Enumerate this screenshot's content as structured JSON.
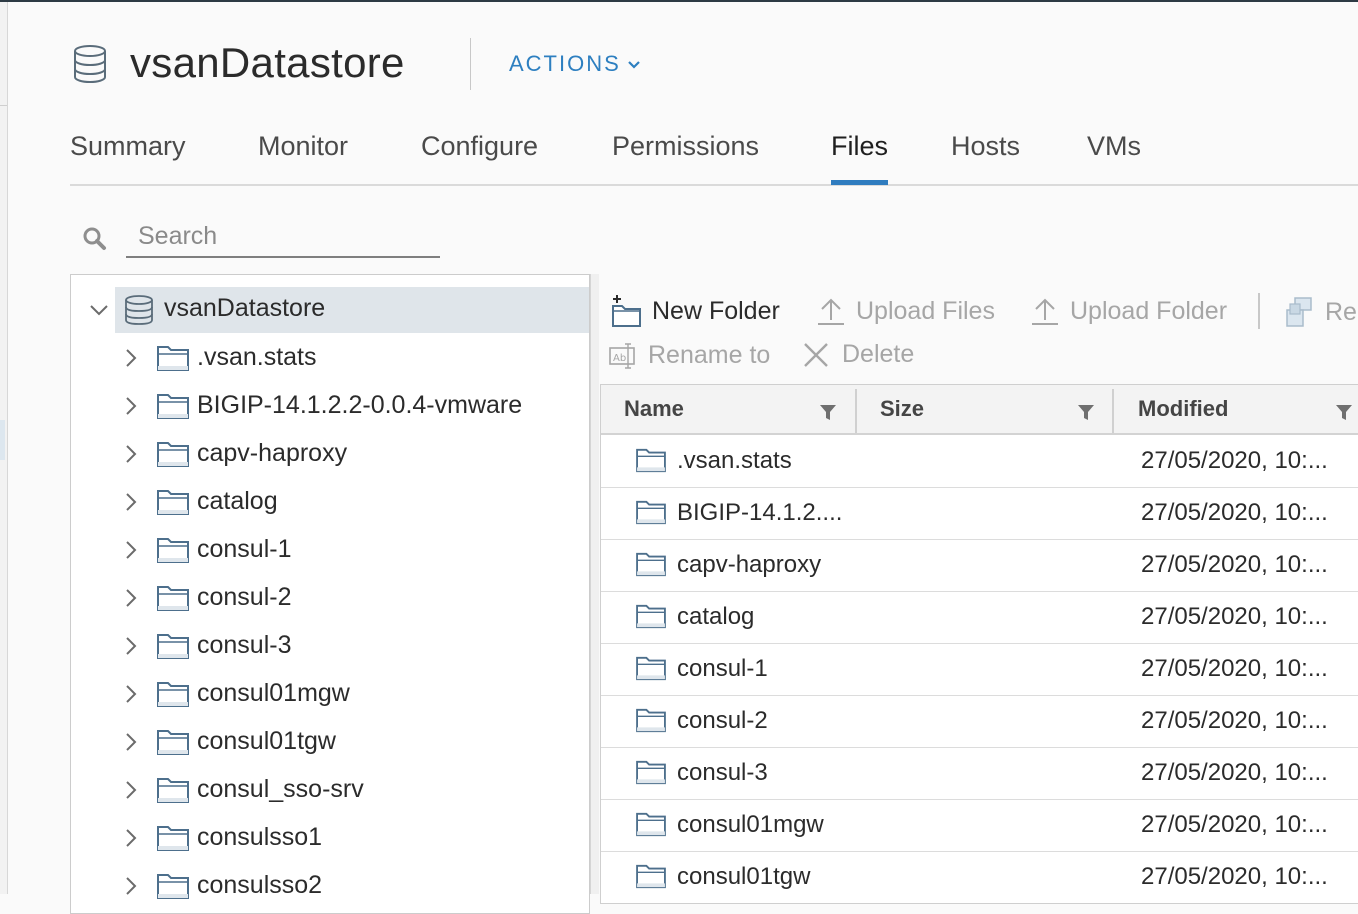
{
  "header": {
    "title": "vsanDatastore",
    "actions_label": "ACTIONS"
  },
  "tabs": [
    {
      "label": "Summary"
    },
    {
      "label": "Monitor"
    },
    {
      "label": "Configure"
    },
    {
      "label": "Permissions"
    },
    {
      "label": "Files",
      "active": true
    },
    {
      "label": "Hosts"
    },
    {
      "label": "VMs"
    }
  ],
  "search": {
    "placeholder": "Search",
    "value": ""
  },
  "tree": {
    "root": "vsanDatastore",
    "items": [
      ".vsan.stats",
      "BIGIP-14.1.2.2-0.0.4-vmware",
      "capv-haproxy",
      "catalog",
      "consul-1",
      "consul-2",
      "consul-3",
      "consul01mgw",
      "consul01tgw",
      "consul_sso-srv",
      "consulsso1",
      "consulsso2"
    ]
  },
  "toolbar": {
    "new_folder": "New Folder",
    "upload_files": "Upload Files",
    "upload_folder": "Upload Folder",
    "register_vm": "Reg",
    "rename_to": "Rename to",
    "delete": "Delete"
  },
  "grid": {
    "columns": [
      "Name",
      "Size",
      "Modified"
    ],
    "rows": [
      {
        "name": ".vsan.stats",
        "size": "",
        "modified": "27/05/2020, 10:..."
      },
      {
        "name": "BIGIP-14.1.2....",
        "size": "",
        "modified": "27/05/2020, 10:..."
      },
      {
        "name": "capv-haproxy",
        "size": "",
        "modified": "27/05/2020, 10:..."
      },
      {
        "name": "catalog",
        "size": "",
        "modified": "27/05/2020, 10:..."
      },
      {
        "name": "consul-1",
        "size": "",
        "modified": "27/05/2020, 10:..."
      },
      {
        "name": "consul-2",
        "size": "",
        "modified": "27/05/2020, 10:..."
      },
      {
        "name": "consul-3",
        "size": "",
        "modified": "27/05/2020, 10:..."
      },
      {
        "name": "consul01mgw",
        "size": "",
        "modified": "27/05/2020, 10:..."
      },
      {
        "name": "consul01tgw",
        "size": "",
        "modified": "27/05/2020, 10:..."
      }
    ]
  },
  "colors": {
    "accent": "#2f7cbf",
    "link": "#2d7fc0",
    "selected_row": "#dfe5ea",
    "folder_stroke": "#4d6f8c"
  },
  "icons": {
    "datastore": "datastore-icon",
    "folder": "folder-icon",
    "search": "search-icon",
    "filter": "filter-icon"
  }
}
